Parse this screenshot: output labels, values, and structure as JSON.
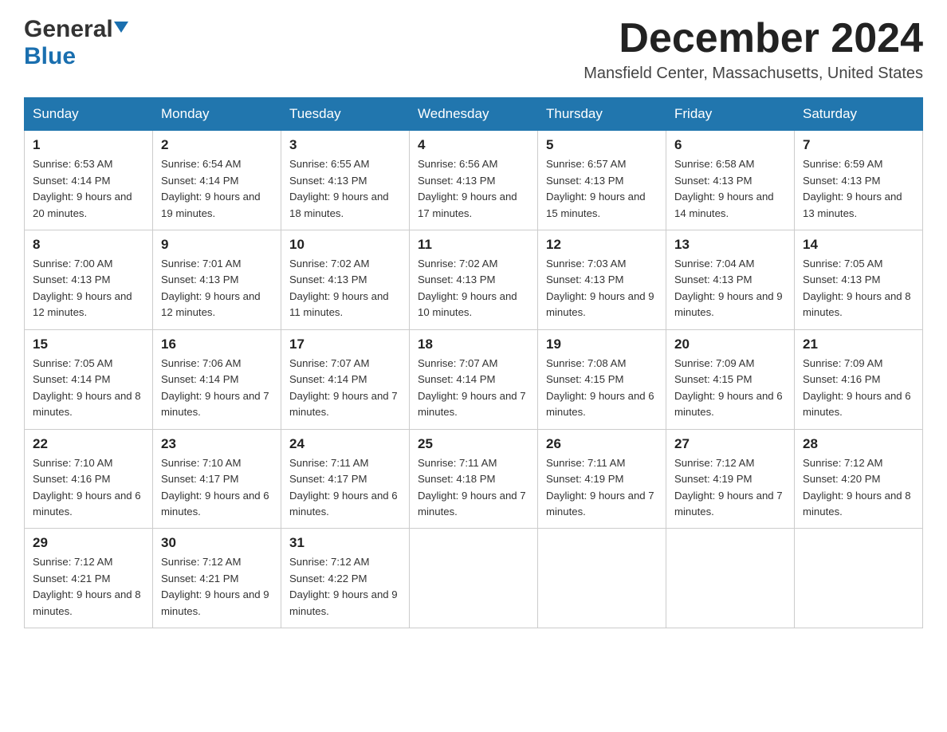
{
  "header": {
    "logo_general": "General",
    "logo_blue": "Blue",
    "month_title": "December 2024",
    "location": "Mansfield Center, Massachusetts, United States"
  },
  "days_of_week": [
    "Sunday",
    "Monday",
    "Tuesday",
    "Wednesday",
    "Thursday",
    "Friday",
    "Saturday"
  ],
  "weeks": [
    [
      {
        "day": "1",
        "sunrise": "Sunrise: 6:53 AM",
        "sunset": "Sunset: 4:14 PM",
        "daylight": "Daylight: 9 hours and 20 minutes."
      },
      {
        "day": "2",
        "sunrise": "Sunrise: 6:54 AM",
        "sunset": "Sunset: 4:14 PM",
        "daylight": "Daylight: 9 hours and 19 minutes."
      },
      {
        "day": "3",
        "sunrise": "Sunrise: 6:55 AM",
        "sunset": "Sunset: 4:13 PM",
        "daylight": "Daylight: 9 hours and 18 minutes."
      },
      {
        "day": "4",
        "sunrise": "Sunrise: 6:56 AM",
        "sunset": "Sunset: 4:13 PM",
        "daylight": "Daylight: 9 hours and 17 minutes."
      },
      {
        "day": "5",
        "sunrise": "Sunrise: 6:57 AM",
        "sunset": "Sunset: 4:13 PM",
        "daylight": "Daylight: 9 hours and 15 minutes."
      },
      {
        "day": "6",
        "sunrise": "Sunrise: 6:58 AM",
        "sunset": "Sunset: 4:13 PM",
        "daylight": "Daylight: 9 hours and 14 minutes."
      },
      {
        "day": "7",
        "sunrise": "Sunrise: 6:59 AM",
        "sunset": "Sunset: 4:13 PM",
        "daylight": "Daylight: 9 hours and 13 minutes."
      }
    ],
    [
      {
        "day": "8",
        "sunrise": "Sunrise: 7:00 AM",
        "sunset": "Sunset: 4:13 PM",
        "daylight": "Daylight: 9 hours and 12 minutes."
      },
      {
        "day": "9",
        "sunrise": "Sunrise: 7:01 AM",
        "sunset": "Sunset: 4:13 PM",
        "daylight": "Daylight: 9 hours and 12 minutes."
      },
      {
        "day": "10",
        "sunrise": "Sunrise: 7:02 AM",
        "sunset": "Sunset: 4:13 PM",
        "daylight": "Daylight: 9 hours and 11 minutes."
      },
      {
        "day": "11",
        "sunrise": "Sunrise: 7:02 AM",
        "sunset": "Sunset: 4:13 PM",
        "daylight": "Daylight: 9 hours and 10 minutes."
      },
      {
        "day": "12",
        "sunrise": "Sunrise: 7:03 AM",
        "sunset": "Sunset: 4:13 PM",
        "daylight": "Daylight: 9 hours and 9 minutes."
      },
      {
        "day": "13",
        "sunrise": "Sunrise: 7:04 AM",
        "sunset": "Sunset: 4:13 PM",
        "daylight": "Daylight: 9 hours and 9 minutes."
      },
      {
        "day": "14",
        "sunrise": "Sunrise: 7:05 AM",
        "sunset": "Sunset: 4:13 PM",
        "daylight": "Daylight: 9 hours and 8 minutes."
      }
    ],
    [
      {
        "day": "15",
        "sunrise": "Sunrise: 7:05 AM",
        "sunset": "Sunset: 4:14 PM",
        "daylight": "Daylight: 9 hours and 8 minutes."
      },
      {
        "day": "16",
        "sunrise": "Sunrise: 7:06 AM",
        "sunset": "Sunset: 4:14 PM",
        "daylight": "Daylight: 9 hours and 7 minutes."
      },
      {
        "day": "17",
        "sunrise": "Sunrise: 7:07 AM",
        "sunset": "Sunset: 4:14 PM",
        "daylight": "Daylight: 9 hours and 7 minutes."
      },
      {
        "day": "18",
        "sunrise": "Sunrise: 7:07 AM",
        "sunset": "Sunset: 4:14 PM",
        "daylight": "Daylight: 9 hours and 7 minutes."
      },
      {
        "day": "19",
        "sunrise": "Sunrise: 7:08 AM",
        "sunset": "Sunset: 4:15 PM",
        "daylight": "Daylight: 9 hours and 6 minutes."
      },
      {
        "day": "20",
        "sunrise": "Sunrise: 7:09 AM",
        "sunset": "Sunset: 4:15 PM",
        "daylight": "Daylight: 9 hours and 6 minutes."
      },
      {
        "day": "21",
        "sunrise": "Sunrise: 7:09 AM",
        "sunset": "Sunset: 4:16 PM",
        "daylight": "Daylight: 9 hours and 6 minutes."
      }
    ],
    [
      {
        "day": "22",
        "sunrise": "Sunrise: 7:10 AM",
        "sunset": "Sunset: 4:16 PM",
        "daylight": "Daylight: 9 hours and 6 minutes."
      },
      {
        "day": "23",
        "sunrise": "Sunrise: 7:10 AM",
        "sunset": "Sunset: 4:17 PM",
        "daylight": "Daylight: 9 hours and 6 minutes."
      },
      {
        "day": "24",
        "sunrise": "Sunrise: 7:11 AM",
        "sunset": "Sunset: 4:17 PM",
        "daylight": "Daylight: 9 hours and 6 minutes."
      },
      {
        "day": "25",
        "sunrise": "Sunrise: 7:11 AM",
        "sunset": "Sunset: 4:18 PM",
        "daylight": "Daylight: 9 hours and 7 minutes."
      },
      {
        "day": "26",
        "sunrise": "Sunrise: 7:11 AM",
        "sunset": "Sunset: 4:19 PM",
        "daylight": "Daylight: 9 hours and 7 minutes."
      },
      {
        "day": "27",
        "sunrise": "Sunrise: 7:12 AM",
        "sunset": "Sunset: 4:19 PM",
        "daylight": "Daylight: 9 hours and 7 minutes."
      },
      {
        "day": "28",
        "sunrise": "Sunrise: 7:12 AM",
        "sunset": "Sunset: 4:20 PM",
        "daylight": "Daylight: 9 hours and 8 minutes."
      }
    ],
    [
      {
        "day": "29",
        "sunrise": "Sunrise: 7:12 AM",
        "sunset": "Sunset: 4:21 PM",
        "daylight": "Daylight: 9 hours and 8 minutes."
      },
      {
        "day": "30",
        "sunrise": "Sunrise: 7:12 AM",
        "sunset": "Sunset: 4:21 PM",
        "daylight": "Daylight: 9 hours and 9 minutes."
      },
      {
        "day": "31",
        "sunrise": "Sunrise: 7:12 AM",
        "sunset": "Sunset: 4:22 PM",
        "daylight": "Daylight: 9 hours and 9 minutes."
      },
      null,
      null,
      null,
      null
    ]
  ],
  "colors": {
    "header_bg": "#2176ae",
    "header_text": "#ffffff",
    "accent_blue": "#1a6faf"
  }
}
